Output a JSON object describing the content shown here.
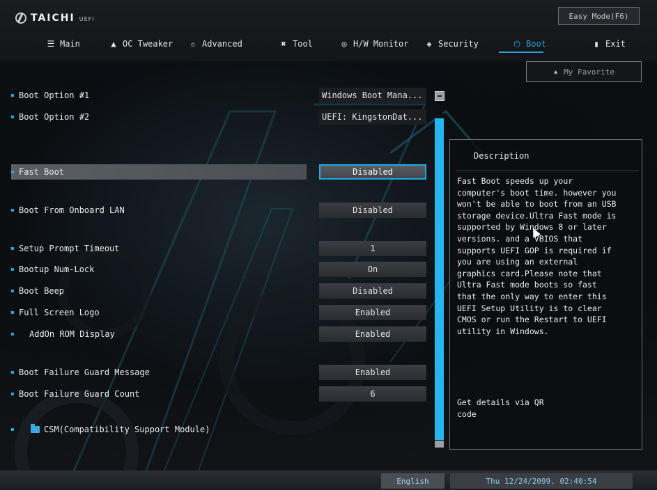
{
  "header": {
    "logo_text": "TAICHI",
    "logo_sub": "UEFI",
    "easy_mode_label": "Easy Mode(F6)",
    "tabs": [
      {
        "label": "Main",
        "icon": "list-icon"
      },
      {
        "label": "OC Tweaker",
        "icon": "rocket-icon"
      },
      {
        "label": "Advanced",
        "icon": "star-icon"
      },
      {
        "label": "Tool",
        "icon": "wrench-icon"
      },
      {
        "label": "H/W Monitor",
        "icon": "monitor-icon"
      },
      {
        "label": "Security",
        "icon": "shield-icon"
      },
      {
        "label": "Boot",
        "icon": "power-icon",
        "active": true
      },
      {
        "label": "Exit",
        "icon": "exit-door-icon"
      }
    ],
    "favorite_label": "My Favorite"
  },
  "boot_options": [
    {
      "label": "Boot Option #1",
      "value": "Windows Boot Mana..."
    },
    {
      "label": "Boot Option #2",
      "value": "UEFI: KingstonDat..."
    }
  ],
  "settings": [
    {
      "label": "Fast Boot",
      "value": "Disabled",
      "selected": true
    },
    {
      "label": "Boot From Onboard LAN",
      "value": "Disabled"
    },
    {
      "label": "Setup Prompt Timeout",
      "value": "1"
    },
    {
      "label": "Bootup Num-Lock",
      "value": "On"
    },
    {
      "label": "Boot Beep",
      "value": "Disabled"
    },
    {
      "label": "Full Screen Logo",
      "value": "Enabled"
    },
    {
      "label": "AddOn ROM Display",
      "value": "Enabled",
      "indent": true
    },
    {
      "label": "Boot Failure Guard Message",
      "value": "Enabled"
    },
    {
      "label": "Boot Failure Guard Count",
      "value": "6"
    }
  ],
  "csm_label": "CSM(Compatibility Support Module)",
  "description": {
    "title": "Description",
    "lines": [
      "Fast Boot speeds up your",
      "computer's boot time. however you",
      "won't be able to boot from an USB",
      "storage device.Ultra Fast mode is",
      "supported by Windows 8 or later",
      "versions. and a VBIOS that",
      "supports UEFI GOP is required if",
      "you are using an external",
      "graphics card.Please note that",
      "Ultra Fast mode boots so fast",
      "that the only way to enter this",
      "UEFI Setup Utility is to clear",
      "CMOS or run the Restart to UEFI",
      "utility in Windows."
    ],
    "qr_line1": "Get details via QR",
    "qr_line2": "code"
  },
  "footer": {
    "language": "English",
    "datetime": "Thu 12/24/2099. 02:40:54"
  },
  "colors": {
    "accent": "#2a9fd8",
    "scrollbar": "#25b6ef",
    "background": "#0b0d10"
  }
}
